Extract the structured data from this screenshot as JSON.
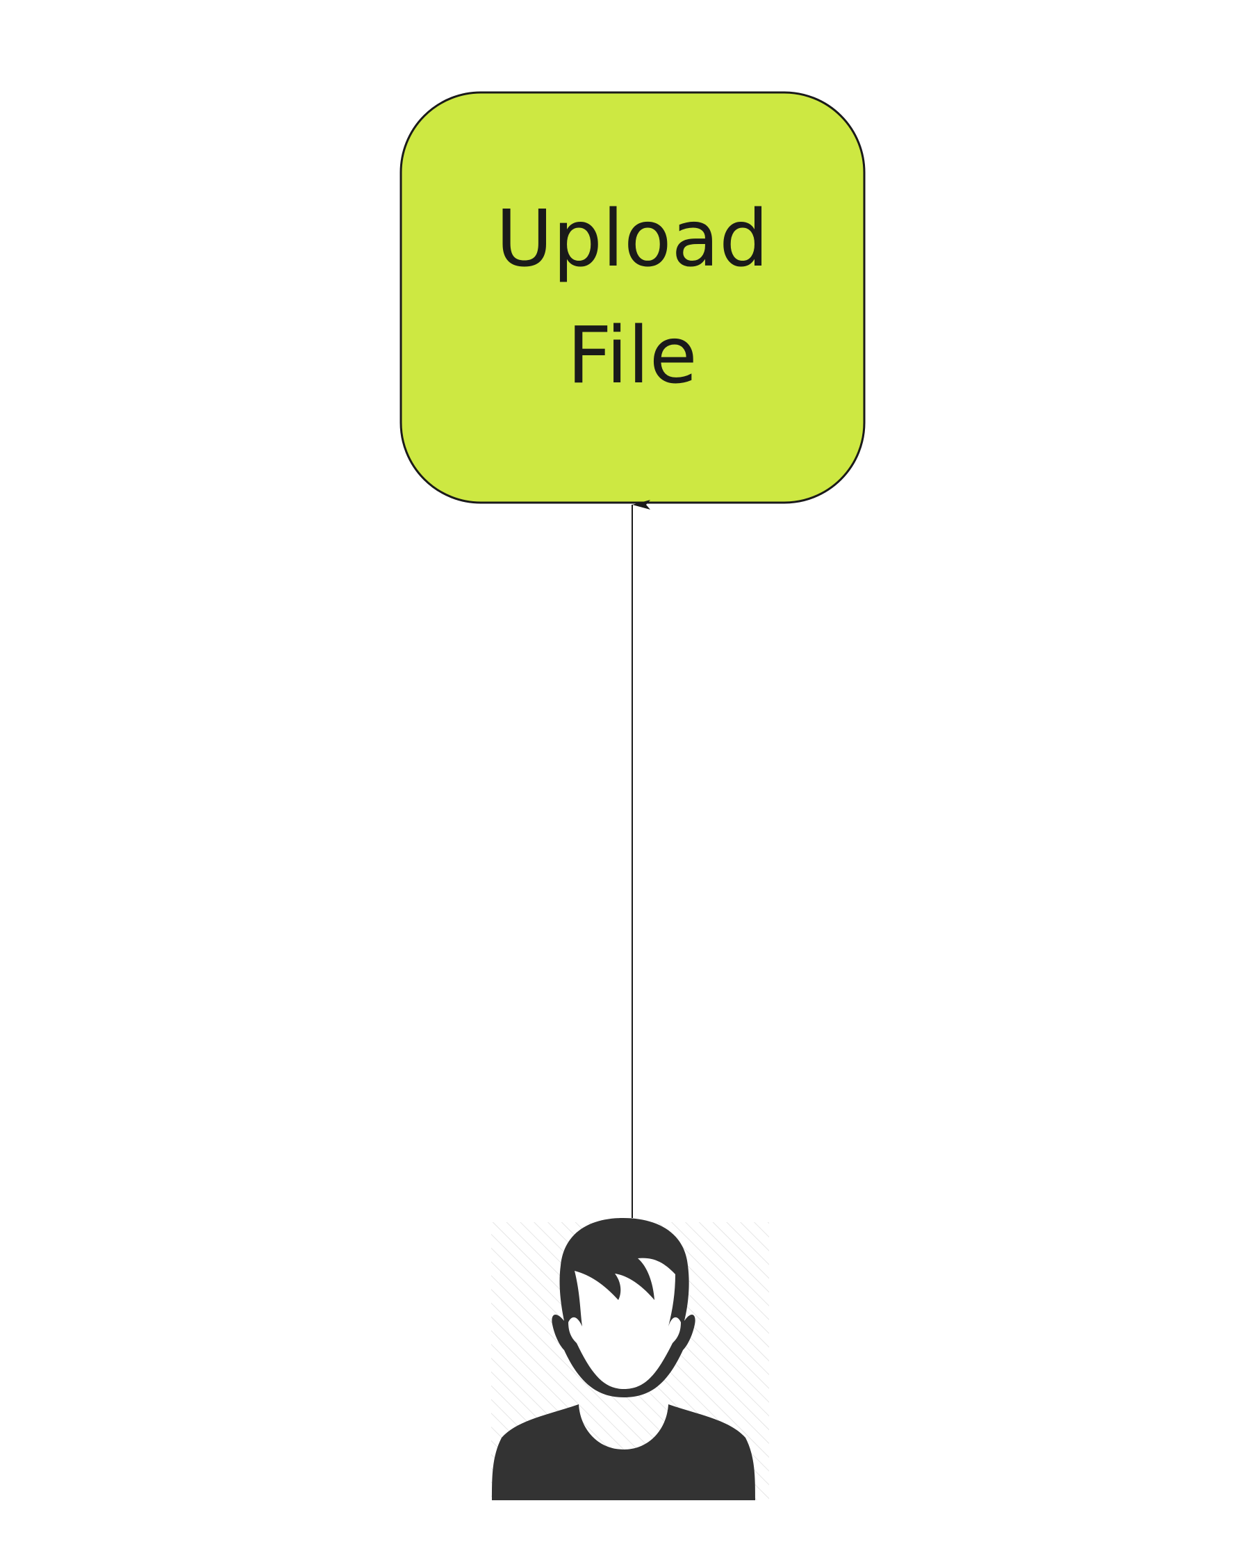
{
  "nodes": {
    "upload_file": {
      "lines": [
        "Upload",
        "File"
      ],
      "fill": "#cde842",
      "stroke": "#1a1a1a"
    },
    "actor": {
      "icon": "user-avatar-icon",
      "color": "#333333"
    }
  },
  "edges": [
    {
      "from": "actor",
      "to": "upload_file",
      "arrow": "end"
    }
  ]
}
